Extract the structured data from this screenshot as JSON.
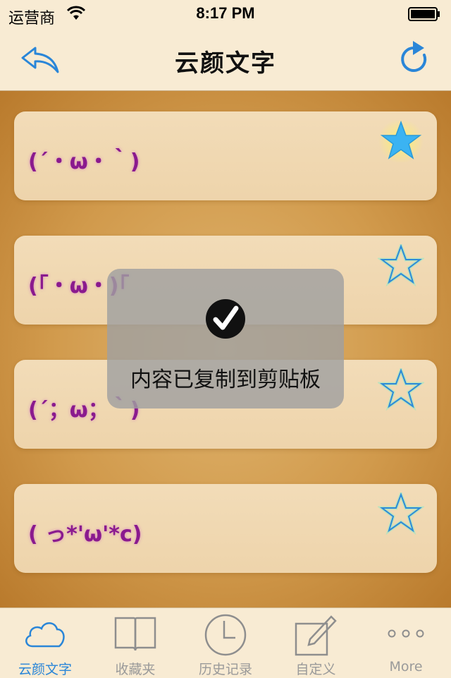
{
  "status_bar": {
    "carrier": "运营商",
    "time": "8:17 PM"
  },
  "nav": {
    "title": "云颜文字",
    "back_icon": "back-reply-icon",
    "refresh_icon": "refresh-icon"
  },
  "cards": [
    {
      "text": "(´・ω・｀)",
      "favorited": true
    },
    {
      "text": "(｢・ω・)｢",
      "favorited": false
    },
    {
      "text": "(´；ω；｀)",
      "favorited": false
    },
    {
      "text": "( っ*'ω'*c)",
      "favorited": false
    }
  ],
  "toast": {
    "message": "内容已复制到剪贴板",
    "icon": "checkmark-icon"
  },
  "tabs": [
    {
      "label": "云颜文字",
      "icon": "cloud-icon",
      "active": true
    },
    {
      "label": "收藏夹",
      "icon": "book-icon",
      "active": false
    },
    {
      "label": "历史记录",
      "icon": "clock-icon",
      "active": false
    },
    {
      "label": "自定义",
      "icon": "edit-icon",
      "active": false
    },
    {
      "label": "More",
      "icon": "more-icon",
      "active": false
    }
  ],
  "colors": {
    "accent": "#2a86d8",
    "kaomoji_text": "#8a1a8e",
    "star_active": "#3bb3f2"
  }
}
